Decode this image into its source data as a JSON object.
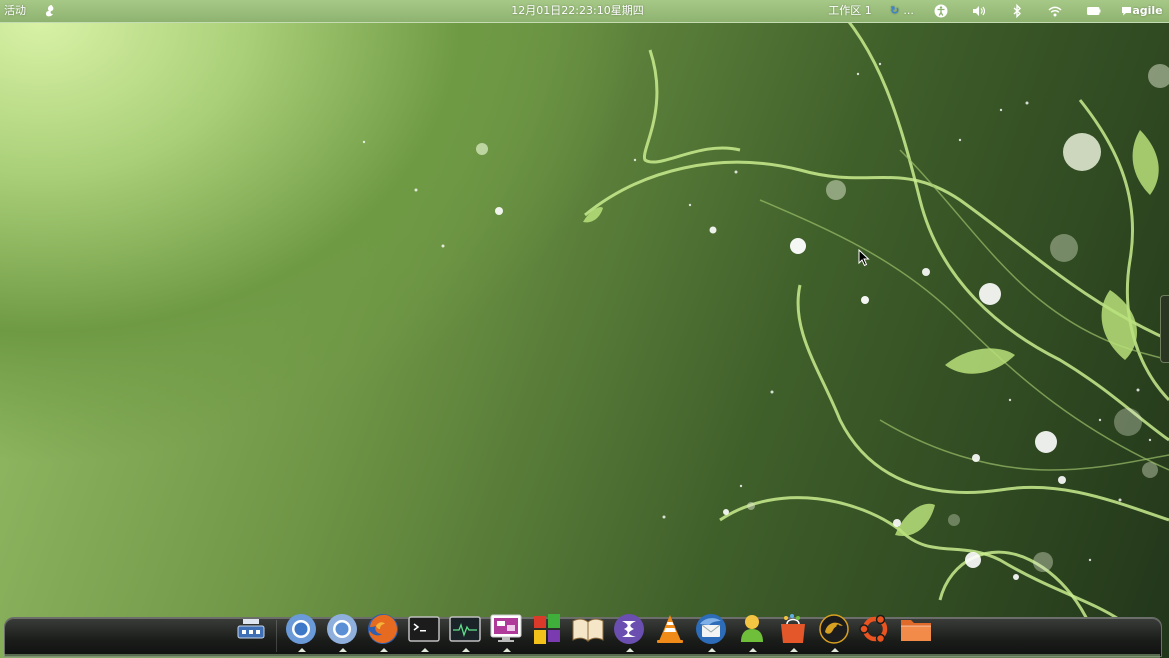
{
  "top_panel": {
    "activities_label": "活动",
    "clock": "12月01日22:23:10星期四",
    "workspace_label": "工作区 1",
    "refresh_ellipsis": "...",
    "user_name": "agile"
  },
  "icons": {
    "app_menu": "app-menu-icon",
    "accessibility": "accessibility-icon",
    "volume": "volume-icon",
    "bluetooth": "bluetooth-icon",
    "wifi": "wifi-icon",
    "battery": "battery-icon",
    "chat": "chat-icon"
  },
  "dock": {
    "items": [
      {
        "name": "network-manager"
      },
      {
        "name": "chromium",
        "running": true
      },
      {
        "name": "chrome",
        "running": true
      },
      {
        "name": "firefox",
        "running": true
      },
      {
        "name": "terminal",
        "running": true
      },
      {
        "name": "system-monitor",
        "running": true
      },
      {
        "name": "remote-desktop",
        "running": true
      },
      {
        "name": "app-launcher"
      },
      {
        "name": "dictionary"
      },
      {
        "name": "emacs",
        "running": true
      },
      {
        "name": "vlc"
      },
      {
        "name": "thunderbird",
        "running": true
      },
      {
        "name": "contacts",
        "running": true
      },
      {
        "name": "software-store",
        "running": true
      },
      {
        "name": "guake-terminal",
        "running": true
      },
      {
        "name": "ubuntu-logo"
      },
      {
        "name": "file-manager"
      }
    ]
  },
  "colors": {
    "accent_green": "#a7c988",
    "dock_bg": "#1a1c1a",
    "refresh_blue": "#3a7fd0"
  }
}
